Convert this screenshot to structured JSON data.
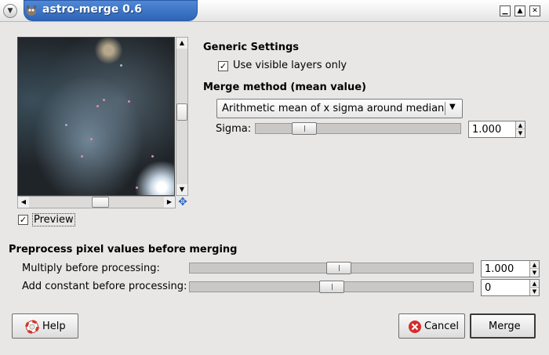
{
  "window": {
    "title": "astro-merge 0.6",
    "menu_icon": "chevron-down-icon",
    "controls": [
      "minimize-icon",
      "maximize-icon",
      "close-icon"
    ]
  },
  "preview": {
    "label": "Preview",
    "checked": true
  },
  "generic": {
    "heading": "Generic Settings",
    "visible_layers_label": "Use visible layers only",
    "visible_layers_checked": true
  },
  "merge": {
    "heading": "Merge method (mean value)",
    "method_selected": "Arithmetic mean of x sigma around median",
    "sigma_label": "Sigma:",
    "sigma_value": "1.000",
    "sigma_slider_fraction": 0.2
  },
  "preprocess": {
    "heading": "Preprocess pixel values before merging",
    "multiply_label": "Multiply before processing:",
    "multiply_value": "1.000",
    "multiply_slider_fraction": 0.53,
    "add_label": "Add constant before processing:",
    "add_value": "0",
    "add_slider_fraction": 0.5
  },
  "buttons": {
    "help": "Help",
    "help_icon": "lifebuoy-icon",
    "cancel": "Cancel",
    "cancel_icon": "cancel-x-icon",
    "merge": "Merge"
  }
}
